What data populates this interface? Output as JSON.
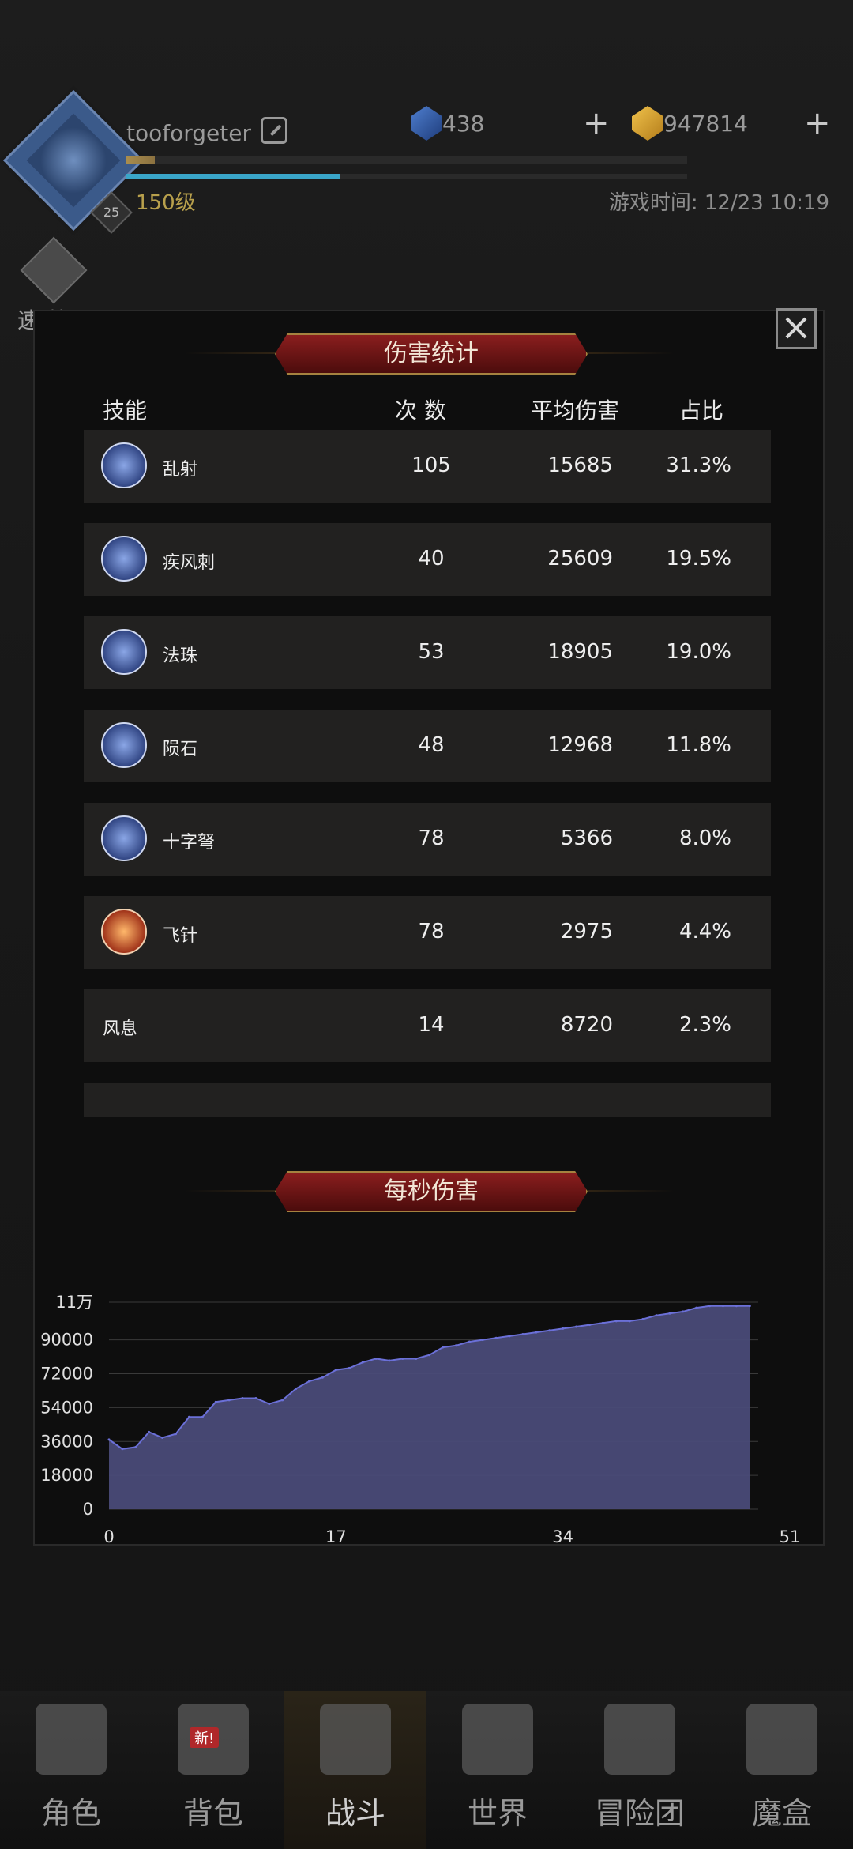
{
  "header": {
    "username": "tooforgeter",
    "level": "150级",
    "avatar_badge": "25",
    "game_time": "游戏时间: 12/23 10:19",
    "xp_progress": 0.05,
    "energy_progress": 0.38,
    "gems": "438",
    "gold": "947814",
    "quick_battle": "速 战"
  },
  "damage_stats": {
    "title": "伤害统计",
    "columns": {
      "skill": "技能",
      "count": "次 数",
      "avg": "平均伤害",
      "ratio": "占比"
    },
    "rows": [
      {
        "name": "乱射",
        "count": "105",
        "avg": "15685",
        "ratio": "31.3%",
        "icon": "arrows-volley-icon",
        "red": false
      },
      {
        "name": "疾风刺",
        "count": "40",
        "avg": "25609",
        "ratio": "19.5%",
        "icon": "gale-thrust-icon",
        "red": false
      },
      {
        "name": "法珠",
        "count": "53",
        "avg": "18905",
        "ratio": "19.0%",
        "icon": "magic-orb-icon",
        "red": false
      },
      {
        "name": "陨石",
        "count": "48",
        "avg": "12968",
        "ratio": "11.8%",
        "icon": "meteor-icon",
        "red": false
      },
      {
        "name": "十字弩",
        "count": "78",
        "avg": "5366",
        "ratio": "8.0%",
        "icon": "crossbow-icon",
        "red": false
      },
      {
        "name": "飞针",
        "count": "78",
        "avg": "2975",
        "ratio": "4.4%",
        "icon": "flying-needle-icon",
        "red": true
      },
      {
        "name": "风息",
        "count": "14",
        "avg": "8720",
        "ratio": "2.3%",
        "icon": "",
        "red": false
      },
      {
        "name": "",
        "count": "",
        "avg": "",
        "ratio": "",
        "icon": "",
        "red": false
      }
    ]
  },
  "dps": {
    "title": "每秒伤害"
  },
  "chart_data": {
    "type": "area",
    "title": "每秒伤害",
    "xlabel": "",
    "ylabel": "",
    "xlim": [
      0,
      51
    ],
    "ylim": [
      0,
      110000
    ],
    "x_ticks": [
      "0",
      "17",
      "34",
      "51"
    ],
    "y_ticks": [
      "0",
      "18000",
      "36000",
      "54000",
      "72000",
      "90000",
      "11万"
    ],
    "color": "#4a4b78",
    "line_color": "#6b70d8",
    "series": [
      {
        "x": [
          0,
          1,
          2,
          3,
          4,
          5,
          6,
          7,
          8,
          9,
          10,
          11,
          12,
          13,
          14,
          15,
          16,
          17,
          18,
          19,
          20,
          21,
          22,
          23,
          24,
          25,
          26,
          27,
          28,
          29,
          30,
          31,
          32,
          33,
          34,
          35,
          36,
          37,
          38,
          39,
          40,
          41,
          42,
          43,
          44,
          45,
          46,
          47,
          48
        ],
        "values": [
          37000,
          32000,
          33000,
          41000,
          38000,
          40000,
          49000,
          49000,
          57000,
          58000,
          59000,
          59000,
          56000,
          58000,
          64000,
          68000,
          70000,
          74000,
          75000,
          78000,
          80000,
          79000,
          80000,
          80000,
          82000,
          86000,
          87000,
          89000,
          90000,
          91000,
          92000,
          93000,
          94000,
          95000,
          96000,
          97000,
          98000,
          99000,
          100000,
          100000,
          101000,
          103000,
          104000,
          105000,
          107000,
          108000,
          108000,
          108000,
          108000
        ]
      }
    ]
  },
  "nav": {
    "items": [
      {
        "label": "角色",
        "icon": "helmet-icon"
      },
      {
        "label": "背包",
        "icon": "backpack-icon"
      },
      {
        "label": "战斗",
        "icon": "sword-shield-icon"
      },
      {
        "label": "世界",
        "icon": "map-scroll-icon"
      },
      {
        "label": "冒险团",
        "icon": "castle-icon"
      },
      {
        "label": "魔盒",
        "icon": "magic-box-icon"
      }
    ],
    "new_badge": "新!"
  }
}
